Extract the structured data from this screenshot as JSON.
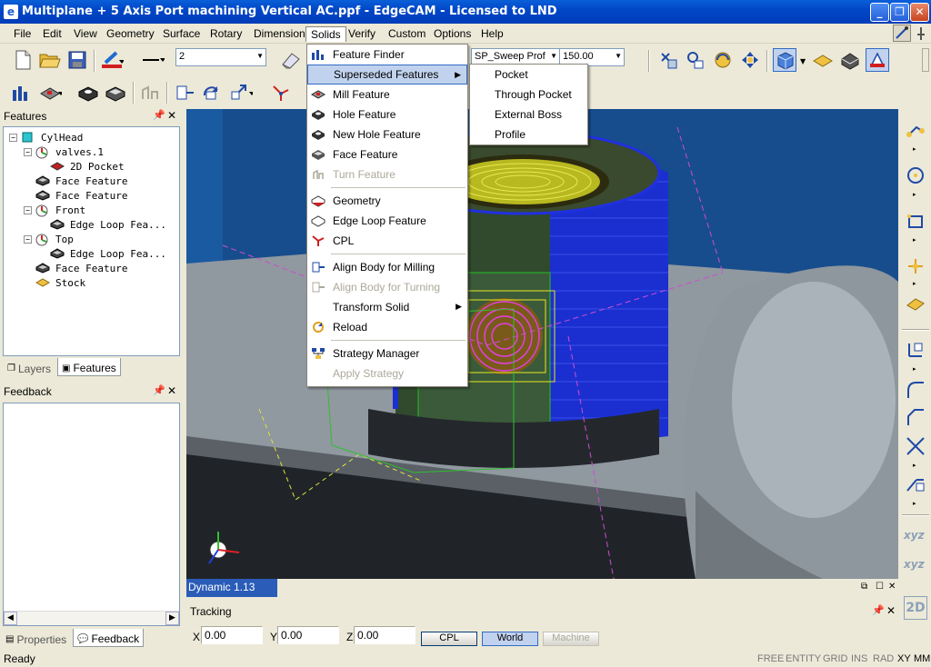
{
  "window": {
    "title": "Multiplane + 5 Axis Port machining Vertical AC.ppf - EdgeCAM - Licensed to LND",
    "app_icon": "e"
  },
  "menubar": [
    "File",
    "Edit",
    "View",
    "Geometry",
    "Surface",
    "Rotary",
    "Dimension",
    "Solids",
    "Verify",
    "Custom",
    "Options",
    "Help"
  ],
  "toolbar": {
    "line_style_value": "2",
    "sweep_combo": "SP_Sweep Prof",
    "value_combo": "150.00"
  },
  "features_panel": {
    "title": "Features",
    "tree": [
      {
        "label": "CylHead",
        "depth": 0,
        "expander": "−"
      },
      {
        "label": "valves.1",
        "depth": 1,
        "expander": "−"
      },
      {
        "label": "2D Pocket",
        "depth": 2,
        "expander": ""
      },
      {
        "label": "Face Feature",
        "depth": 1,
        "expander": ""
      },
      {
        "label": "Face Feature",
        "depth": 1,
        "expander": ""
      },
      {
        "label": "Front",
        "depth": 1,
        "expander": "−"
      },
      {
        "label": "Edge Loop Fea...",
        "depth": 2,
        "expander": ""
      },
      {
        "label": "Top",
        "depth": 1,
        "expander": "−"
      },
      {
        "label": "Edge Loop Fea...",
        "depth": 2,
        "expander": ""
      },
      {
        "label": "Face Feature",
        "depth": 1,
        "expander": ""
      },
      {
        "label": "Stock",
        "depth": 1,
        "expander": ""
      }
    ],
    "tabs": [
      "Layers",
      "Features"
    ]
  },
  "feedback_panel": {
    "title": "Feedback",
    "tabs": [
      "Properties",
      "Feedback"
    ]
  },
  "solids_menu": {
    "items": [
      {
        "label": "Feature Finder",
        "state": "normal",
        "submenu": false
      },
      {
        "label": "Superseded Features",
        "state": "highlight",
        "submenu": true
      },
      {
        "label": "Mill Feature",
        "state": "normal",
        "submenu": false
      },
      {
        "label": "Hole Feature",
        "state": "normal",
        "submenu": false
      },
      {
        "label": "New Hole Feature",
        "state": "normal",
        "submenu": false
      },
      {
        "label": "Face Feature",
        "state": "normal",
        "submenu": false
      },
      {
        "label": "Turn Feature",
        "state": "disabled",
        "submenu": false
      },
      {
        "sep": true
      },
      {
        "label": "Geometry",
        "state": "normal",
        "submenu": false
      },
      {
        "label": "Edge Loop Feature",
        "state": "normal",
        "submenu": false
      },
      {
        "label": "CPL",
        "state": "normal",
        "submenu": false
      },
      {
        "sep": true
      },
      {
        "label": "Align Body for Milling",
        "state": "normal",
        "submenu": false
      },
      {
        "label": "Align Body for Turning",
        "state": "disabled",
        "submenu": false
      },
      {
        "label": "Transform Solid",
        "state": "normal",
        "submenu": true
      },
      {
        "label": "Reload",
        "state": "normal",
        "submenu": false
      },
      {
        "sep": true
      },
      {
        "label": "Strategy Manager",
        "state": "normal",
        "submenu": false
      },
      {
        "label": "Apply Strategy",
        "state": "disabled",
        "submenu": false
      }
    ]
  },
  "superseded_submenu": [
    "Pocket",
    "Through Pocket",
    "External Boss",
    "Profile"
  ],
  "viewport": {
    "label": "Dynamic 1.13"
  },
  "tracking": {
    "title": "Tracking",
    "x_label": "X",
    "y_label": "Y",
    "z_label": "Z",
    "x": "0.00",
    "y": "0.00",
    "z": "0.00",
    "cpl_btn": "CPL",
    "world_btn": "World",
    "machine_btn": "Machine"
  },
  "status": {
    "text": "Ready",
    "indicators": [
      "FREE",
      "ENTITY",
      "GRID",
      "INS",
      "RAD",
      "XY",
      "MM"
    ]
  },
  "right_toolbar": {
    "xyz_label": "xyz",
    "twod_label": "2D"
  },
  "colors": {
    "titlebar": "#0047c8",
    "viewport_bg": "#174d8c",
    "menu_highlight": "#c1d2ee",
    "selection": "#316ac5"
  }
}
